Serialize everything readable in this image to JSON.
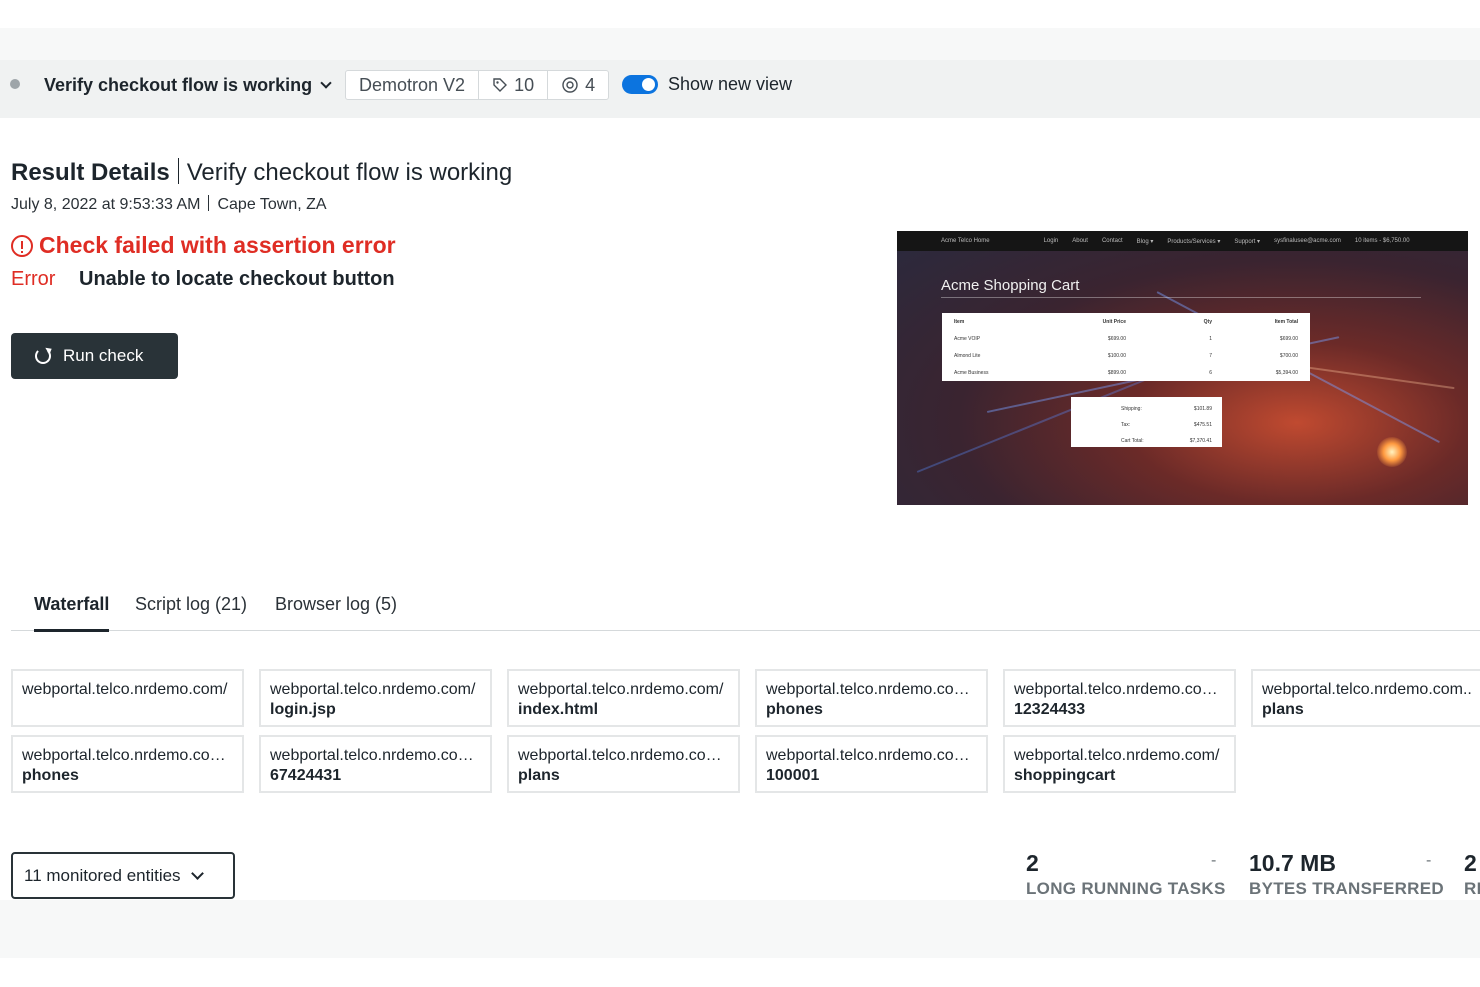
{
  "header": {
    "check_name": "Verify checkout flow is working",
    "account": "Demotron V2",
    "tags_count": "10",
    "locations_count": "4",
    "toggle_label": "Show new view",
    "toggle_on": true
  },
  "result": {
    "title": "Result Details",
    "check_name": "Verify checkout flow is working",
    "timestamp": "July 8, 2022 at 9:53:33 AM",
    "location": "Cape Town, ZA",
    "failure": "Check failed with assertion error",
    "error_label": "Error",
    "error_message": "Unable to locate checkout button",
    "run_button": "Run check"
  },
  "screenshot": {
    "site_name": "Acme Telco Home",
    "nav": [
      "Login",
      "About",
      "Contact",
      "Blog ▾",
      "Products/Services ▾",
      "Support ▾",
      "sysfinalusee@acme.com",
      "10 items - $6,750.00"
    ],
    "heading": "Acme Shopping Cart",
    "table_headers": [
      "Item",
      "Unit Price",
      "Qty",
      "Item Total"
    ],
    "rows": [
      [
        "Acme VOIP",
        "$699.00",
        "1",
        "$699.00"
      ],
      [
        "Almond Lite",
        "$100.00",
        "7",
        "$700.00"
      ],
      [
        "Acme Business",
        "$899.00",
        "6",
        "$5,394.00"
      ]
    ],
    "totals": [
      [
        "Shipping:",
        "$101.89"
      ],
      [
        "Tax:",
        "$475.51"
      ],
      [
        "Cart Total:",
        "$7,370.41"
      ]
    ]
  },
  "tabs": [
    {
      "label": "Waterfall",
      "active": true
    },
    {
      "label": "Script log (21)",
      "active": false
    },
    {
      "label": "Browser log (5)",
      "active": false
    }
  ],
  "waterfall": [
    {
      "url": "webportal.telco.nrdemo.com/",
      "path": ""
    },
    {
      "url": "webportal.telco.nrdemo.com/",
      "path": "login.jsp"
    },
    {
      "url": "webportal.telco.nrdemo.com/",
      "path": "index.html"
    },
    {
      "url": "webportal.telco.nrdemo.com...",
      "path": "phones"
    },
    {
      "url": "webportal.telco.nrdemo.com...",
      "path": "12324433"
    },
    {
      "url": "webportal.telco.nrdemo.com...",
      "path": "plans"
    },
    {
      "url": "webportal.telco.nrdemo.com...",
      "path": "phones"
    },
    {
      "url": "webportal.telco.nrdemo.com...",
      "path": "67424431"
    },
    {
      "url": "webportal.telco.nrdemo.com...",
      "path": "plans"
    },
    {
      "url": "webportal.telco.nrdemo.com...",
      "path": "100001"
    },
    {
      "url": "webportal.telco.nrdemo.com/",
      "path": "shoppingcart"
    }
  ],
  "entities_button": "11 monitored entities",
  "metrics": [
    {
      "value": "2",
      "label": "LONG RUNNING TASKS"
    },
    {
      "value": "10.7 MB",
      "label": "BYTES TRANSFERRED"
    },
    {
      "value": "2",
      "label": "RE"
    }
  ],
  "metric_separator": "-",
  "colors": {
    "error": "#df2d24",
    "button": "#293338",
    "toggle": "#0c74df"
  }
}
